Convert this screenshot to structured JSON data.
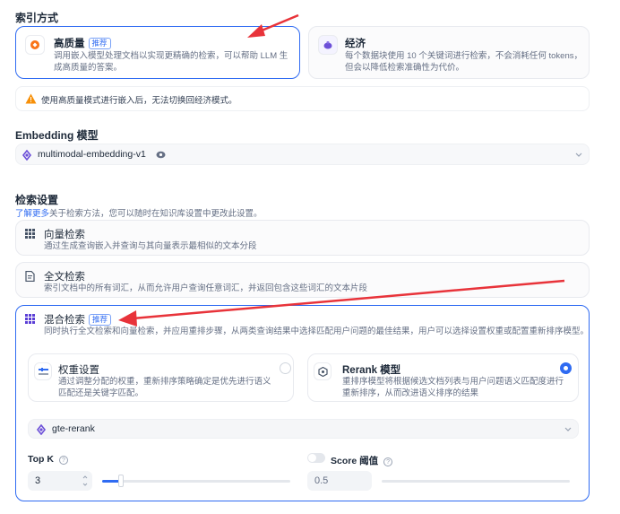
{
  "index_mode": {
    "title": "索引方式",
    "high_quality": {
      "label": "高质量",
      "badge": "推荐",
      "desc": "调用嵌入模型处理文档以实现更精确的检索，可以帮助 LLM 生成高质量的答案。"
    },
    "economy": {
      "label": "经济",
      "desc": "每个数据块使用 10 个关键词进行检索，不会消耗任何 tokens，但会以降低检索准确性为代价。"
    },
    "warning": "使用高质量模式进行嵌入后，无法切换回经济模式。"
  },
  "embedding": {
    "title": "Embedding 模型",
    "model": "multimodal-embedding-v1"
  },
  "retrieval": {
    "title": "检索设置",
    "learn_more": "了解更多",
    "subtitle": "关于检索方法，您可以随时在知识库设置中更改此设置。",
    "vector": {
      "label": "向量检索",
      "desc": "通过生成查询嵌入并查询与其向量表示最相似的文本分段"
    },
    "fulltext": {
      "label": "全文检索",
      "desc": "索引文档中的所有词汇，从而允许用户查询任意词汇，并返回包含这些词汇的文本片段"
    },
    "hybrid": {
      "label": "混合检索",
      "badge": "推荐",
      "desc": "同时执行全文检索和向量检索，并应用重排步骤，从两类查询结果中选择匹配用户问题的最佳结果，用户可以选择设置权重或配置重新排序模型。",
      "weight": {
        "label": "权重设置",
        "desc": "通过调整分配的权重，重新排序策略确定是优先进行语义匹配还是关键字匹配。"
      },
      "rerank": {
        "label": "Rerank 模型",
        "desc": "重排序模型将根据候选文档列表与用户问题语义匹配度进行重新排序，从而改进语义排序的结果"
      },
      "rerank_model": "gte-rerank",
      "top_k": {
        "label": "Top K",
        "value": "3",
        "slider_fraction": 0.1
      },
      "score": {
        "label": "Score 阈值",
        "value": "0.5",
        "slider_fraction": 0.0,
        "enabled": false
      }
    }
  },
  "colors": {
    "accent": "#2f6bf2",
    "arrow": "#e8333a",
    "warning": "#f79009"
  }
}
